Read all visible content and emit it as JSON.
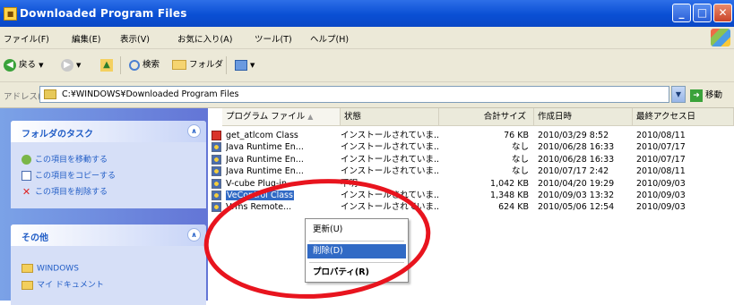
{
  "window": {
    "title": "Downloaded Program Files",
    "controls": {
      "minimize": "_",
      "maximize": "□",
      "close": "✕"
    }
  },
  "menu": [
    "ファイル(F)",
    "編集(E)",
    "表示(V)",
    "お気に入り(A)",
    "ツール(T)",
    "ヘルプ(H)"
  ],
  "toolbar": {
    "back": "戻る",
    "search": "検索",
    "folders": "フォルダ"
  },
  "address": {
    "label": "アドレス(D)",
    "path": "C:¥WINDOWS¥Downloaded Program Files",
    "go_label": "移動"
  },
  "sidebar": {
    "tasks_title": "フォルダのタスク",
    "tasks": [
      "この項目を移動する",
      "この項目をコピーする",
      "この項目を削除する"
    ],
    "other_title": "その他",
    "other": [
      "WINDOWS",
      "マイ ドキュメント"
    ]
  },
  "columns": [
    "プログラム ファイル",
    "状態",
    "合計サイズ",
    "作成日時",
    "最終アクセス日"
  ],
  "files": [
    {
      "name": "get_atlcom Class",
      "status": "インストールされていま...",
      "size": "76 KB",
      "created": "2010/03/29 8:52",
      "accessed": "2010/08/11",
      "icon": "red"
    },
    {
      "name": "Java Runtime En...",
      "status": "インストールされていま...",
      "size": "なし",
      "created": "2010/06/28 16:33",
      "accessed": "2010/07/17",
      "icon": "gear"
    },
    {
      "name": "Java Runtime En...",
      "status": "インストールされていま...",
      "size": "なし",
      "created": "2010/06/28 16:33",
      "accessed": "2010/07/17",
      "icon": "gear"
    },
    {
      "name": "Java Runtime En...",
      "status": "インストールされていま...",
      "size": "なし",
      "created": "2010/07/17 2:42",
      "accessed": "2010/08/11",
      "icon": "gear"
    },
    {
      "name": "V-cube Plug-in",
      "status": "不明",
      "size": "1,042 KB",
      "created": "2010/04/20 19:29",
      "accessed": "2010/09/03",
      "icon": "gear"
    },
    {
      "name": "VeControl Class",
      "status": "インストールされていま...",
      "size": "1,348 KB",
      "created": "2010/09/03 13:32",
      "accessed": "2010/09/03",
      "icon": "gear",
      "selected": true
    },
    {
      "name": "Vrms Remote...",
      "status": "インストールされていま...",
      "size": "624 KB",
      "created": "2010/05/06 12:54",
      "accessed": "2010/09/03",
      "icon": "gear"
    }
  ],
  "context_menu": [
    "更新(U)",
    "削除(D)",
    "プロパティ(R)"
  ],
  "colors": {
    "titlebar": "#0a4fd4",
    "selection": "#316ac5",
    "annotation": "#e8141e"
  }
}
